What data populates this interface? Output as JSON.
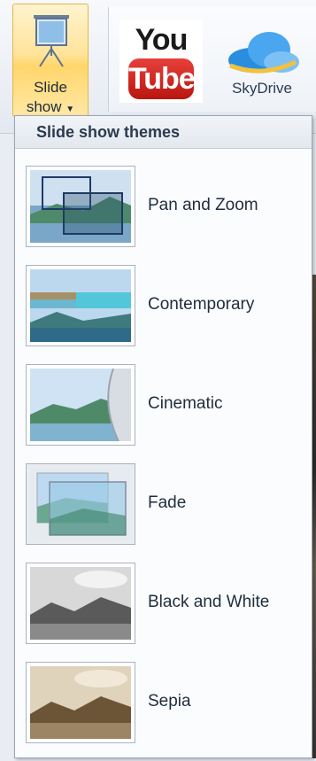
{
  "ribbon": {
    "slideshow_button": {
      "line1": "Slide",
      "line2": "show",
      "icon": "projector-icon"
    },
    "youtube": {
      "top": "You",
      "bottom": "Tube",
      "icon": "youtube-logo"
    },
    "skydrive": {
      "label": "SkyDrive",
      "icon": "cloud-icon"
    }
  },
  "menu": {
    "header": "Slide show themes",
    "items": [
      {
        "label": "Pan and Zoom",
        "thumb": "pan-zoom-thumbnail"
      },
      {
        "label": "Contemporary",
        "thumb": "contemporary-thumbnail"
      },
      {
        "label": "Cinematic",
        "thumb": "cinematic-thumbnail"
      },
      {
        "label": "Fade",
        "thumb": "fade-thumbnail"
      },
      {
        "label": "Black and White",
        "thumb": "black-white-thumbnail"
      },
      {
        "label": "Sepia",
        "thumb": "sepia-thumbnail"
      }
    ]
  }
}
